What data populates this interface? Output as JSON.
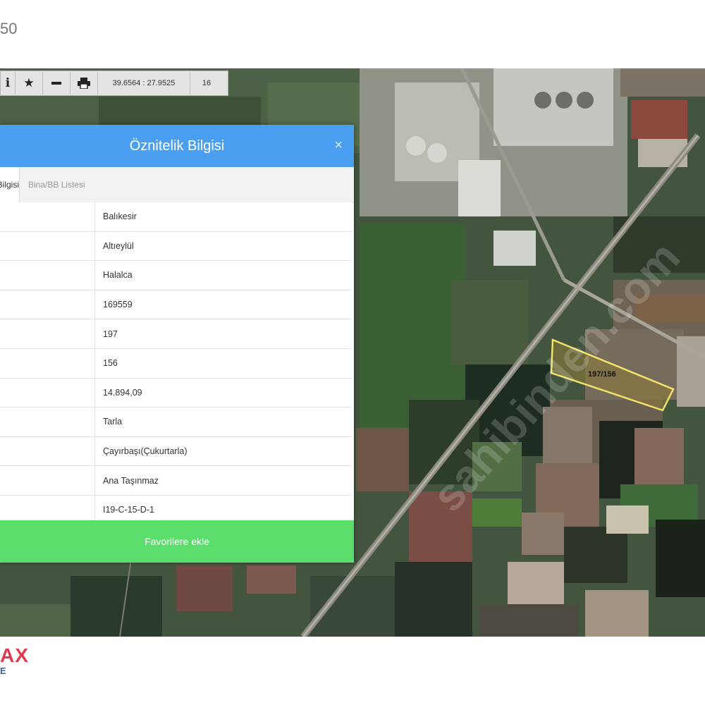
{
  "page": {
    "top_number": "50"
  },
  "toolbar": {
    "info_icon": "info-icon",
    "star_icon": "star-icon",
    "measure_icon": "minus-icon",
    "print_icon": "printer-icon",
    "coordinates": "39.6564 : 27.9525",
    "zoom": "16"
  },
  "panel": {
    "title": "Öznitelik Bilgisi",
    "close_label": "×",
    "tabs": [
      {
        "label": "Bilgisi"
      },
      {
        "label": "Bina/BB Listesi"
      }
    ],
    "rows": [
      {
        "value": "Balıkesir"
      },
      {
        "value": "Altıeylül"
      },
      {
        "value": "Halalca"
      },
      {
        "value": "169559"
      },
      {
        "value": "197"
      },
      {
        "value": "156"
      },
      {
        "value": "14.894,09"
      },
      {
        "value": "Tarla"
      },
      {
        "value": "Çayırbaşı(Çukurtarla)"
      },
      {
        "value": "Ana Taşınmaz"
      },
      {
        "value": "I19-C-15-D-1"
      }
    ],
    "favorite_button": "Favorilere ekle"
  },
  "map": {
    "parcel_label": "197/156",
    "parcel_outline_color": "#f2e26a",
    "watermark": "sahibinden.com"
  },
  "branding": {
    "logo": "AX",
    "logo_sub": "E"
  }
}
